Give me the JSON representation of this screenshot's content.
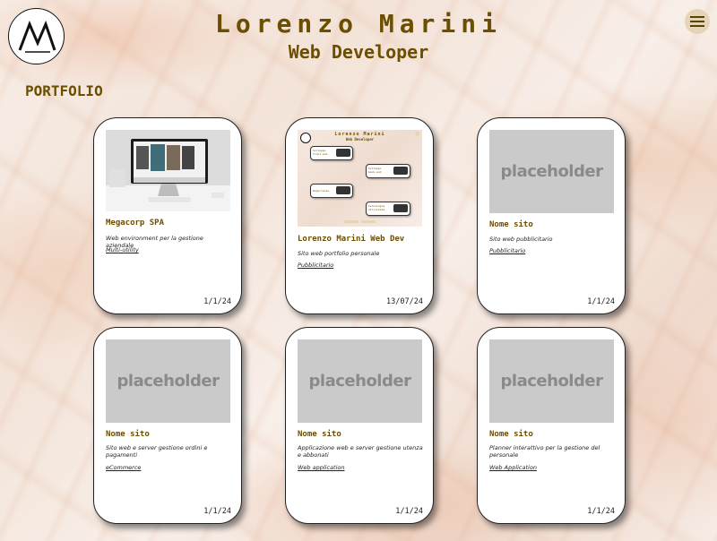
{
  "header": {
    "title": "Lorenzo Marini",
    "subtitle": "Web Developer",
    "logo_icon": "logo-m-icon",
    "menu_icon": "hamburger-menu-icon"
  },
  "section_title": "PORTFOLIO",
  "placeholder_text": "placeholder",
  "mini": {
    "title": "Lorenzo Marini",
    "subtitle": "Web Developer",
    "label_development": "Sviluppo",
    "label_frontend": "front-end",
    "label_backend": "back-end",
    "label_experience": "Esperienze",
    "label_technologies": "tecnologie",
    "label_utilized": "utilizzate"
  },
  "cards": [
    {
      "name": "Megacorp SPA",
      "description": "Web environment per la gestione aziendale",
      "category": "Multi-utility",
      "date": "1/1/24",
      "image": "photo"
    },
    {
      "name": "Lorenzo Marini Web Dev",
      "description": "Sito web portfolio personale",
      "category": "Pubblicitario",
      "date": "13/07/24",
      "image": "screenshot"
    },
    {
      "name": "Nome sito",
      "description": "Sito web pubblicitario",
      "category": "Pubblicitario",
      "date": "1/1/24",
      "image": "placeholder"
    },
    {
      "name": "Nome sito",
      "description": "Sito web e server gestione ordini e pagamenti",
      "category": "eCommerce",
      "date": "1/1/24",
      "image": "placeholder"
    },
    {
      "name": "Nome sito",
      "description": "Applicazione web e server gestione utenza e abbonati",
      "category": "Web application",
      "date": "1/1/24",
      "image": "placeholder"
    },
    {
      "name": "Nome sito",
      "description": "Planner interattivo per la gestione del personale",
      "category": "Web Application",
      "date": "1/1/24",
      "image": "placeholder"
    }
  ],
  "colors": {
    "accent": "#6b4e00",
    "placeholder_bg": "#cacaca",
    "card_bg": "#ffffff"
  }
}
